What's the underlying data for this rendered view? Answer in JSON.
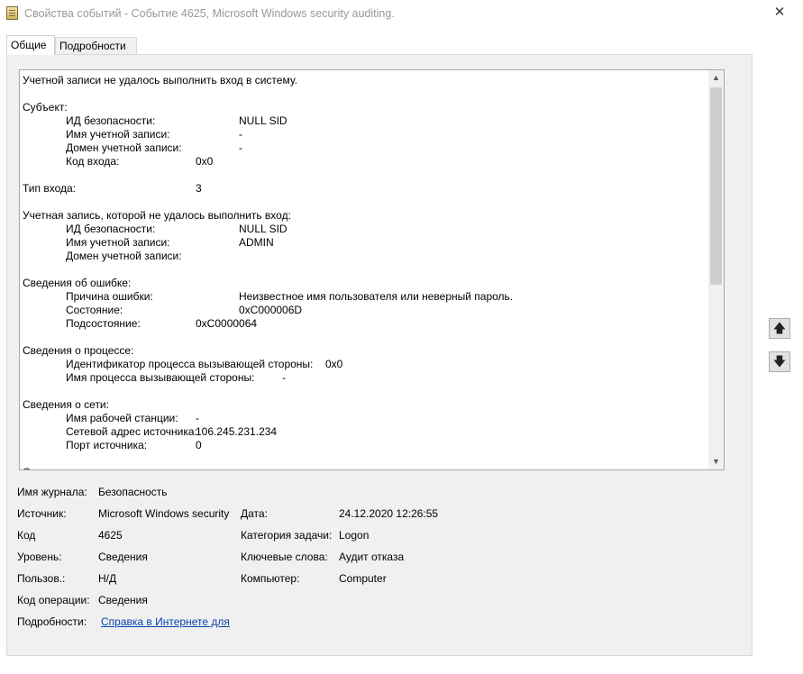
{
  "window": {
    "title": "Свойства событий - Событие 4625, Microsoft Windows security auditing.",
    "close_glyph": "✕"
  },
  "tabs": [
    {
      "label": "Общие",
      "active": true
    },
    {
      "label": "Подробности",
      "active": false
    }
  ],
  "description": {
    "header": "Учетной записи не удалось выполнить вход в систему.",
    "subject": {
      "title": "Субъект:",
      "security_id": {
        "key": "ИД безопасности:",
        "value": "NULL SID"
      },
      "account_name": {
        "key": "Имя учетной записи:",
        "value": "-"
      },
      "account_domain": {
        "key": "Домен учетной записи:",
        "value": "-"
      },
      "logon_id": {
        "key": "Код входа:",
        "value": "0x0"
      }
    },
    "logon_type": {
      "key": "Тип входа:",
      "value": "3"
    },
    "failed_account": {
      "title": "Учетная запись, которой не удалось выполнить вход:",
      "security_id": {
        "key": "ИД безопасности:",
        "value": "NULL SID"
      },
      "account_name": {
        "key": "Имя учетной записи:",
        "value": "ADMIN"
      },
      "account_domain": {
        "key": "Домен учетной записи:",
        "value": ""
      }
    },
    "failure": {
      "title": "Сведения об ошибке:",
      "reason": {
        "key": "Причина ошибки:",
        "value": "Неизвестное имя пользователя или неверный пароль."
      },
      "status": {
        "key": "Состояние:",
        "value": "0xC000006D"
      },
      "sub_status": {
        "key": "Подсостояние:",
        "value": "0xC0000064"
      }
    },
    "process": {
      "title": "Сведения о процессе:",
      "caller_pid": {
        "key": "Идентификатор процесса вызывающей стороны:",
        "value": "0x0"
      },
      "caller_name": {
        "key": "Имя процесса вызывающей стороны:",
        "value": "-"
      }
    },
    "network": {
      "title": "Сведения о сети:",
      "workstation": {
        "key": "Имя рабочей станции:",
        "value": "-"
      },
      "source_address": {
        "key": "Сетевой адрес источника:",
        "value": "106.245.231.234"
      },
      "source_port": {
        "key": "Порт источника:",
        "value": "0"
      }
    },
    "clipped_next": "С"
  },
  "properties": {
    "log_name": {
      "label": "Имя журнала:",
      "value": "Безопасность"
    },
    "source": {
      "label": "Источник:",
      "value": "Microsoft Windows security"
    },
    "logged": {
      "label": "Дата:",
      "value": "24.12.2020 12:26:55"
    },
    "event_id": {
      "label": "Код",
      "value": "4625"
    },
    "task_category": {
      "label": "Категория задачи:",
      "value": "Logon"
    },
    "level": {
      "label": "Уровень:",
      "value": "Сведения"
    },
    "keywords": {
      "label": "Ключевые слова:",
      "value": "Аудит отказа"
    },
    "user": {
      "label": "Пользов.:",
      "value": "Н/Д"
    },
    "computer": {
      "label": "Компьютер:",
      "value": "Computer"
    },
    "opcode": {
      "label": "Код операции:",
      "value": "Сведения"
    },
    "more_info": {
      "label": "Подробности:",
      "value": "Справка в Интернете для"
    }
  },
  "nav": {
    "up_glyph": "🡅",
    "down_glyph": "🡇"
  }
}
